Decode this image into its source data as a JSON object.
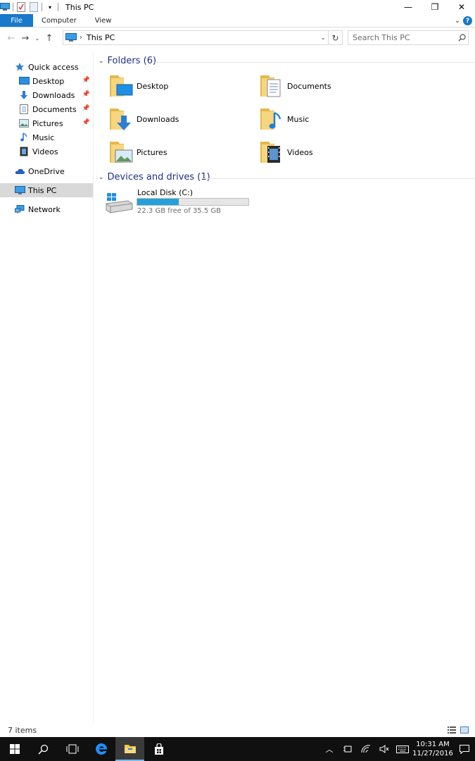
{
  "window": {
    "title": "This PC",
    "minimize": "—",
    "restore": "❐",
    "close": "✕"
  },
  "ribbon": {
    "tabs": [
      {
        "label": "File"
      },
      {
        "label": "Computer"
      },
      {
        "label": "View"
      }
    ],
    "help": "?"
  },
  "address": {
    "path": "This PC",
    "search_placeholder": "Search This PC"
  },
  "nav": {
    "quick_access": "Quick access",
    "items": [
      {
        "label": "Desktop",
        "pinned": true
      },
      {
        "label": "Downloads",
        "pinned": true
      },
      {
        "label": "Documents",
        "pinned": true
      },
      {
        "label": "Pictures",
        "pinned": true
      },
      {
        "label": "Music",
        "pinned": false
      },
      {
        "label": "Videos",
        "pinned": false
      }
    ],
    "onedrive": "OneDrive",
    "this_pc": "This PC",
    "network": "Network"
  },
  "content": {
    "folders_header": "Folders (6)",
    "folders": [
      {
        "label": "Desktop",
        "icon": "desktop-folder-icon"
      },
      {
        "label": "Documents",
        "icon": "documents-folder-icon"
      },
      {
        "label": "Downloads",
        "icon": "downloads-folder-icon"
      },
      {
        "label": "Music",
        "icon": "music-folder-icon"
      },
      {
        "label": "Pictures",
        "icon": "pictures-folder-icon"
      },
      {
        "label": "Videos",
        "icon": "videos-folder-icon"
      }
    ],
    "devices_header": "Devices and drives (1)",
    "drive": {
      "name": "Local Disk (C:)",
      "free_text": "22.3 GB free of 35.5 GB",
      "used_fraction": 0.372
    }
  },
  "status": {
    "items": "7 items"
  },
  "taskbar": {
    "time": "10:31 AM",
    "date": "11/27/2016"
  },
  "colors": {
    "accent": "#1979ca",
    "header_text": "#1e3287",
    "folder_yellow": "#f3d27a",
    "drive_fill": "#26a0da"
  }
}
